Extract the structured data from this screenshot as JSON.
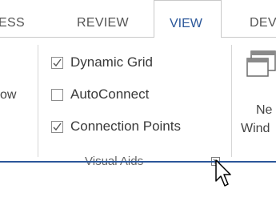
{
  "tabs": {
    "access_fragment": "ESS",
    "review": "REVIEW",
    "view": "VIEW",
    "developer_fragment": "DEV"
  },
  "left_group": {
    "label_fragment": "ow"
  },
  "visual_aids": {
    "group_label": "Visual Aids",
    "checkboxes": [
      {
        "label": "Dynamic Grid",
        "checked": true
      },
      {
        "label": "AutoConnect",
        "checked": false
      },
      {
        "label": "Connection Points",
        "checked": true
      }
    ]
  },
  "window_group": {
    "new_line1": "Ne",
    "new_line2": "Wind"
  },
  "icons": {
    "launcher": "dialog-launcher-icon",
    "new_window": "new-window-icon",
    "cursor": "mouse-pointer-icon"
  },
  "colors": {
    "accent": "#2b579a",
    "text": "#444444"
  }
}
